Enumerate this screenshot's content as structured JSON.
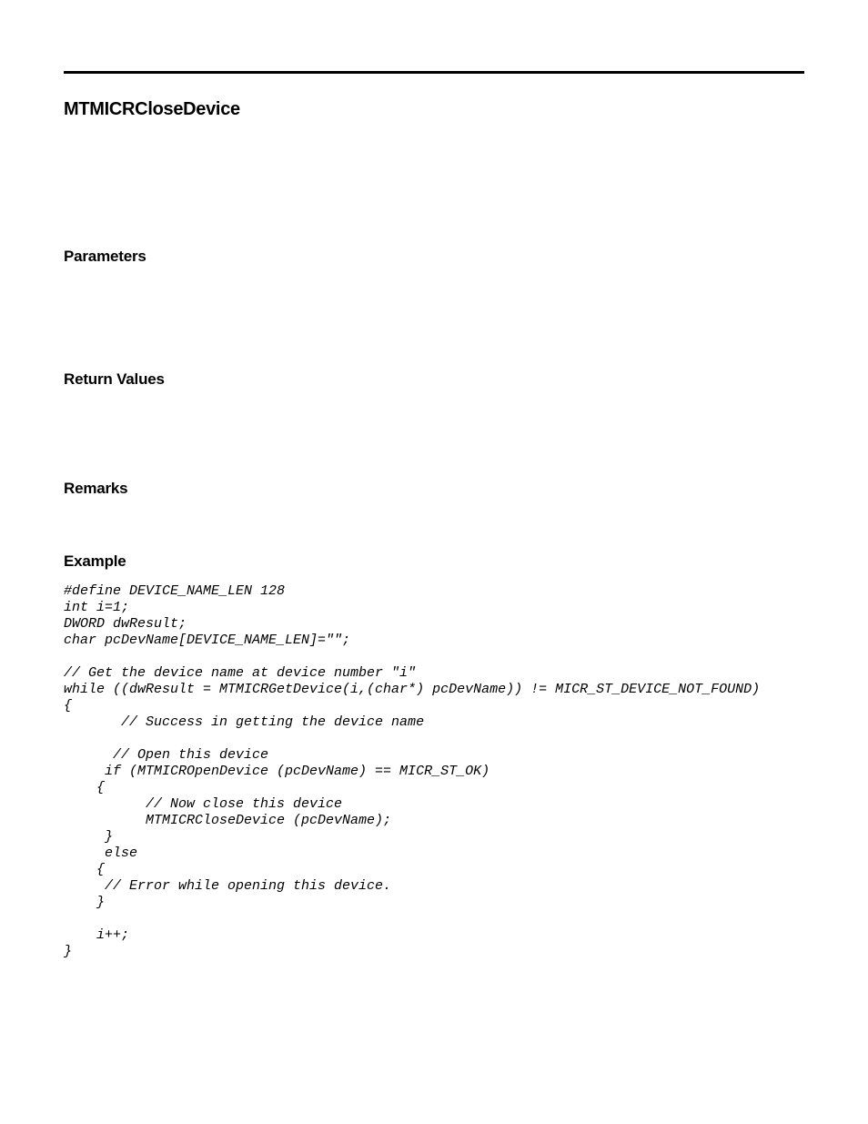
{
  "title": "MTMICRCloseDevice",
  "sections": {
    "parameters": "Parameters",
    "return_values": "Return Values",
    "remarks": "Remarks",
    "example": "Example"
  },
  "code_lines": [
    "#define DEVICE_NAME_LEN 128",
    "int i=1;",
    "DWORD dwResult;",
    "char pcDevName[DEVICE_NAME_LEN]=\"\";",
    "",
    "// Get the device name at device number \"i\"",
    "while ((dwResult = MTMICRGetDevice(i,(char*) pcDevName)) != MICR_ST_DEVICE_NOT_FOUND)",
    "{",
    "       // Success in getting the device name",
    "",
    "      // Open this device",
    "     if (MTMICROpenDevice (pcDevName) == MICR_ST_OK)",
    "    {",
    "          // Now close this device",
    "          MTMICRCloseDevice (pcDevName);",
    "     }",
    "     else",
    "    {",
    "     // Error while opening this device.",
    "    }",
    "",
    "    i++;",
    "}"
  ]
}
